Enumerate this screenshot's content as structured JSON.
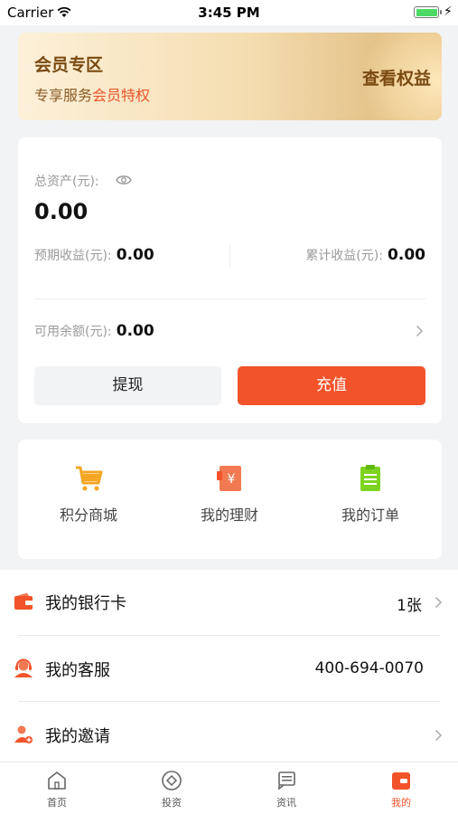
{
  "status_bar": {
    "carrier": "Carrier",
    "time": "3:45 PM",
    "battery_icon": "battery-charging-icon"
  },
  "vip": {
    "title": "会员专区",
    "subtitle_prefix": "专享服务",
    "subtitle_highlight": "会员特权",
    "link": "查看权益"
  },
  "assets": {
    "total_label": "总资产(元):",
    "total_value": "0.00",
    "expected_label": "预期收益(元):",
    "expected_value": "0.00",
    "cumulative_label": "累计收益(元):",
    "cumulative_value": "0.00",
    "available_label": "可用余额(元):",
    "available_value": "0.00",
    "withdraw": "提现",
    "recharge": "充值"
  },
  "shortcuts": [
    {
      "label": "积分商城",
      "icon": "cart-icon"
    },
    {
      "label": "我的理财",
      "icon": "finance-icon"
    },
    {
      "label": "我的订单",
      "icon": "order-icon"
    }
  ],
  "list": [
    {
      "label": "我的银行卡",
      "value": "1张",
      "icon": "wallet-icon"
    },
    {
      "label": "我的客服",
      "value": "400-694-0070",
      "icon": "customer-service-icon"
    },
    {
      "label": "我的邀请",
      "value": "",
      "icon": "invite-icon"
    }
  ],
  "tabs": [
    {
      "label": "首页",
      "icon": "home-icon",
      "active": false
    },
    {
      "label": "投资",
      "icon": "invest-icon",
      "active": false
    },
    {
      "label": "资讯",
      "icon": "news-icon",
      "active": false
    },
    {
      "label": "我的",
      "icon": "wallet-icon",
      "active": true
    }
  ],
  "colors": {
    "accent": "#f2532a",
    "gold_text": "#7a4a12",
    "cart": "#f5a623",
    "order": "#7ed321"
  }
}
